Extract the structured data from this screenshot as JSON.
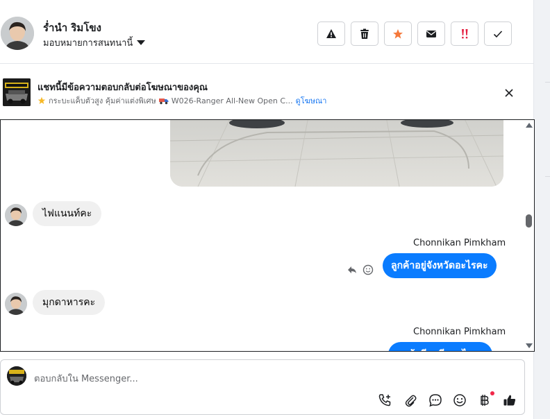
{
  "header": {
    "name": "ร่ำนำ ริมโขง",
    "assign_label": "มอบหมายการสนทนานี้",
    "actions": [
      {
        "icon": "warning-icon",
        "color": "#1c1e21"
      },
      {
        "icon": "trash-icon",
        "color": "#1c1e21"
      },
      {
        "icon": "star-icon",
        "color": "#f5793b"
      },
      {
        "icon": "envelope-icon",
        "color": "#1c1e21"
      },
      {
        "icon": "urgent-icon",
        "color": "#e41e3f"
      },
      {
        "icon": "check-icon",
        "color": "#1c1e21"
      }
    ]
  },
  "ad": {
    "title": "แชทนี้มีข้อความตอบกลับต่อโฆษณาของคุณ",
    "subtitle": "กระบะแค็บตัวสูง คุ้มค่าแต่งพิเศษ",
    "product": "W026-Ranger All-New Open C...",
    "link": "ดูโฆษณา"
  },
  "messages": [
    {
      "direction": "in",
      "text": "ไฟแนนท์คะ"
    },
    {
      "direction": "out",
      "sender": "Chonnikan Pimkham",
      "text": "ลูกค้าอยู่จังหวัดอะไรคะ"
    },
    {
      "direction": "in",
      "text": "มุกดาหารคะ"
    },
    {
      "direction": "out",
      "sender": "Chonnikan Pimkham",
      "text": "ลูกค้ามีอาชีพอะไรคะ"
    }
  ],
  "composer": {
    "placeholder": "ตอบกลับใน Messenger..."
  },
  "colors": {
    "accent": "#0a7cff",
    "link": "#1877f2",
    "notify": "#f02849"
  }
}
